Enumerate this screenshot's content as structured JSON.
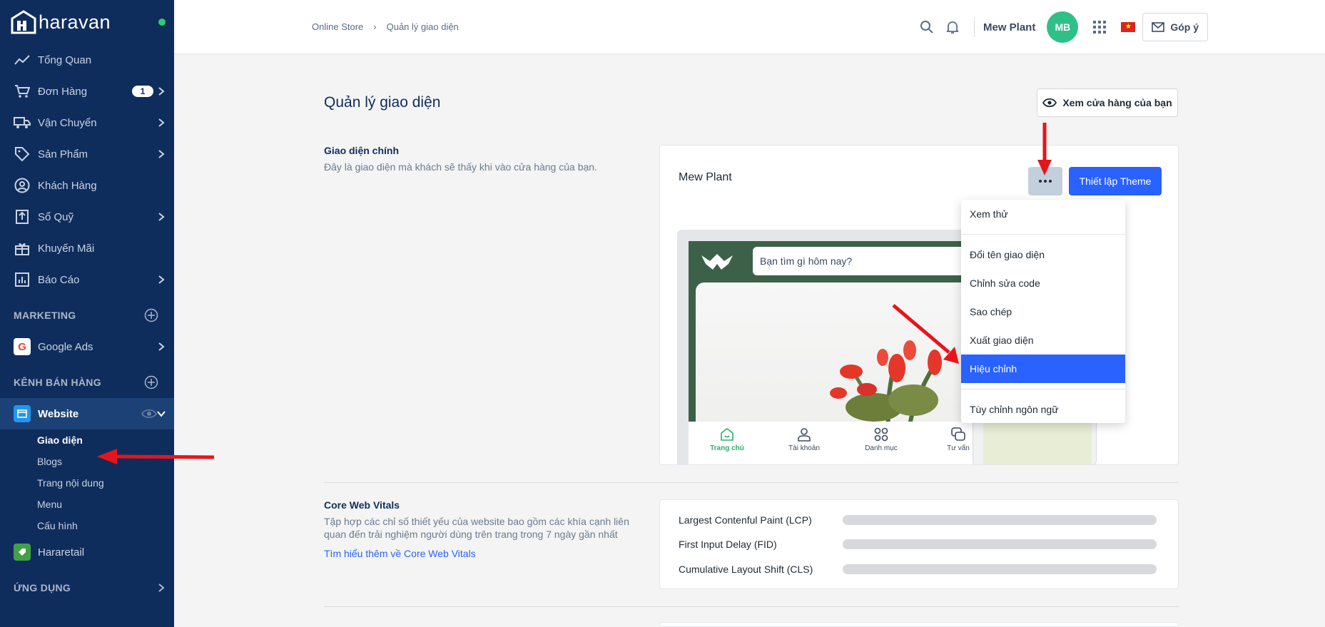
{
  "app": {
    "logo_text": "haravan"
  },
  "sidebar": {
    "items": [
      {
        "label": "Tổng Quan",
        "icon": "trending-icon"
      },
      {
        "label": "Đơn Hàng",
        "icon": "cart-icon",
        "badge": "1"
      },
      {
        "label": "Vận Chuyển",
        "icon": "truck-icon"
      },
      {
        "label": "Sản Phẩm",
        "icon": "tag-icon"
      },
      {
        "label": "Khách Hàng",
        "icon": "user-icon"
      },
      {
        "label": "Sổ Quỹ",
        "icon": "cashbook-icon"
      },
      {
        "label": "Khuyến Mãi",
        "icon": "gift-icon"
      },
      {
        "label": "Báo Cáo",
        "icon": "chart-icon"
      }
    ],
    "marketing_title": "MARKETING",
    "marketing_items": [
      {
        "label": "Google Ads"
      }
    ],
    "sales_title": "KÊNH BÁN HÀNG",
    "website_label": "Website",
    "website_sub": [
      "Giao diện",
      "Blogs",
      "Trang nội dung",
      "Menu",
      "Cấu hình"
    ],
    "hararetail_label": "Hararetail",
    "apps_title": "ỨNG DỤNG"
  },
  "header": {
    "breadcrumb": [
      "Online Store",
      "›",
      "Quản lý giao diện"
    ],
    "store_name": "Mew Plant",
    "avatar_initials": "MB",
    "flag_star": "★",
    "feedback_label": "Góp ý"
  },
  "main": {
    "page_title": "Quản lý giao diện",
    "view_store_label": "Xem cửa hàng của bạn",
    "main_theme": {
      "title": "Giao diện chính",
      "desc": "Đây là giao diện mà khách sẽ thấy khi vào cửa hàng của bạn.",
      "theme_name": "Mew Plant",
      "setup_label": "Thiết lập Theme",
      "preview": {
        "search_placeholder": "Bạn tìm gì hôm nay?",
        "nav": [
          "Trang chủ",
          "Tài khoản",
          "Danh mục",
          "Tư vấn"
        ]
      }
    },
    "dropdown": {
      "items_top": [
        "Xem thử"
      ],
      "items_mid": [
        "Đổi tên giao diện",
        "Chỉnh sửa code",
        "Sao chép",
        "Xuất giao diện",
        "Hiệu chỉnh"
      ],
      "items_bottom": [
        "Tùy chỉnh ngôn ngữ"
      ],
      "highlighted": "Hiệu chỉnh"
    },
    "core_web_vitals": {
      "title": "Core Web Vitals",
      "desc": "Tập hợp các chỉ số thiết yếu của website bao gồm các khía cạnh liên quan đến trải nghiệm người dùng trên trang trong 7 ngày gần nhất",
      "link": "Tìm hiểu thêm về Core Web Vitals",
      "metrics": [
        "Largest Contenful Paint (LCP)",
        "First Input Delay (FID)",
        "Cumulative Layout Shift (CLS)"
      ]
    }
  },
  "colors": {
    "sidebar_bg": "#0f2d5c",
    "accent": "#2962ff",
    "avatar": "#2fc08a",
    "annotation_arrow": "#e8141b"
  }
}
